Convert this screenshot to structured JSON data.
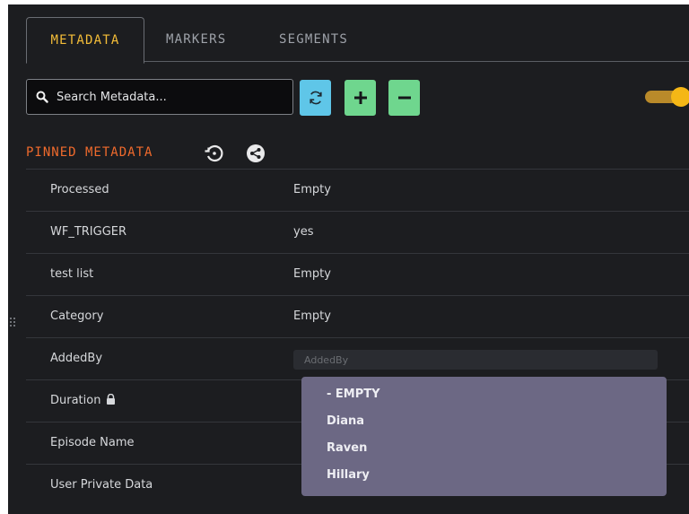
{
  "tabs": [
    {
      "label": "METADATA",
      "active": true
    },
    {
      "label": "MARKERS",
      "active": false
    },
    {
      "label": "SEGMENTS",
      "active": false
    }
  ],
  "search": {
    "placeholder": "Search Metadata..."
  },
  "toolbar": {
    "refresh_icon": "refresh-icon",
    "add_icon": "plus-icon",
    "remove_icon": "minus-icon",
    "toggle_on": true
  },
  "pinned": {
    "title": "PINNED METADATA",
    "icons": [
      "history-icon",
      "share-icon"
    ]
  },
  "rows": [
    {
      "label": "Processed",
      "value": "Empty"
    },
    {
      "label": "WF_TRIGGER",
      "value": "yes"
    },
    {
      "label": "test list",
      "value": "Empty"
    },
    {
      "label": "Category",
      "value": "Empty"
    },
    {
      "label": "AddedBy",
      "placeholder": "AddedBy"
    },
    {
      "label": "Duration",
      "locked": true
    },
    {
      "label": "Episode Name"
    },
    {
      "label": "User Private Data"
    }
  ],
  "dropdown": {
    "options": [
      "- EMPTY",
      "Diana",
      "Raven",
      "Hillary"
    ]
  },
  "colors": {
    "background": "#1c1d20",
    "active_tab": "#f4bd38",
    "section_title": "#ef6a2c",
    "refresh_button": "#5fc6e8",
    "add_button": "#6fd68e",
    "toggle": "#f5b716",
    "dropdown_bg": "#6c6884"
  }
}
